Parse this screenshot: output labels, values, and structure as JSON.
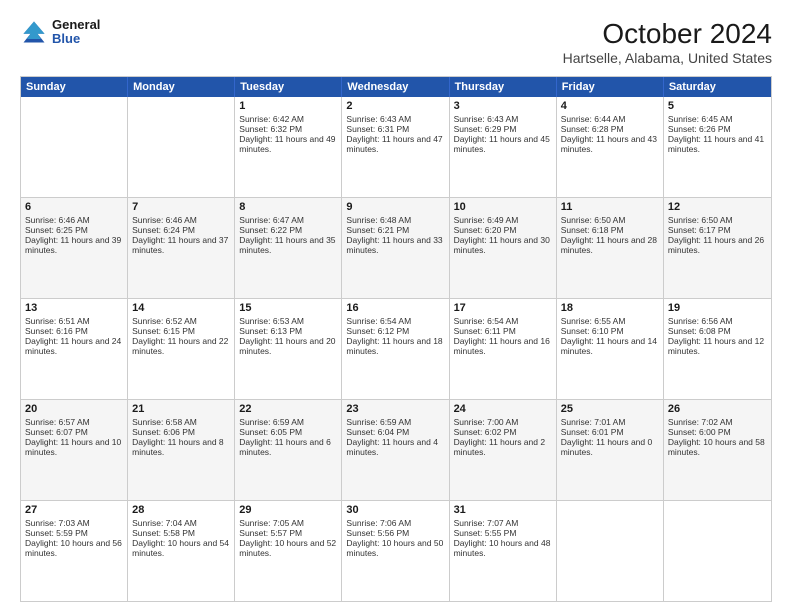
{
  "logo": {
    "general": "General",
    "blue": "Blue"
  },
  "title": "October 2024",
  "subtitle": "Hartselle, Alabama, United States",
  "days_of_week": [
    "Sunday",
    "Monday",
    "Tuesday",
    "Wednesday",
    "Thursday",
    "Friday",
    "Saturday"
  ],
  "weeks": [
    {
      "alt": false,
      "cells": [
        {
          "day": "",
          "content": ""
        },
        {
          "day": "",
          "content": ""
        },
        {
          "day": "1",
          "content": "Sunrise: 6:42 AM\nSunset: 6:32 PM\nDaylight: 11 hours and 49 minutes."
        },
        {
          "day": "2",
          "content": "Sunrise: 6:43 AM\nSunset: 6:31 PM\nDaylight: 11 hours and 47 minutes."
        },
        {
          "day": "3",
          "content": "Sunrise: 6:43 AM\nSunset: 6:29 PM\nDaylight: 11 hours and 45 minutes."
        },
        {
          "day": "4",
          "content": "Sunrise: 6:44 AM\nSunset: 6:28 PM\nDaylight: 11 hours and 43 minutes."
        },
        {
          "day": "5",
          "content": "Sunrise: 6:45 AM\nSunset: 6:26 PM\nDaylight: 11 hours and 41 minutes."
        }
      ]
    },
    {
      "alt": true,
      "cells": [
        {
          "day": "6",
          "content": "Sunrise: 6:46 AM\nSunset: 6:25 PM\nDaylight: 11 hours and 39 minutes."
        },
        {
          "day": "7",
          "content": "Sunrise: 6:46 AM\nSunset: 6:24 PM\nDaylight: 11 hours and 37 minutes."
        },
        {
          "day": "8",
          "content": "Sunrise: 6:47 AM\nSunset: 6:22 PM\nDaylight: 11 hours and 35 minutes."
        },
        {
          "day": "9",
          "content": "Sunrise: 6:48 AM\nSunset: 6:21 PM\nDaylight: 11 hours and 33 minutes."
        },
        {
          "day": "10",
          "content": "Sunrise: 6:49 AM\nSunset: 6:20 PM\nDaylight: 11 hours and 30 minutes."
        },
        {
          "day": "11",
          "content": "Sunrise: 6:50 AM\nSunset: 6:18 PM\nDaylight: 11 hours and 28 minutes."
        },
        {
          "day": "12",
          "content": "Sunrise: 6:50 AM\nSunset: 6:17 PM\nDaylight: 11 hours and 26 minutes."
        }
      ]
    },
    {
      "alt": false,
      "cells": [
        {
          "day": "13",
          "content": "Sunrise: 6:51 AM\nSunset: 6:16 PM\nDaylight: 11 hours and 24 minutes."
        },
        {
          "day": "14",
          "content": "Sunrise: 6:52 AM\nSunset: 6:15 PM\nDaylight: 11 hours and 22 minutes."
        },
        {
          "day": "15",
          "content": "Sunrise: 6:53 AM\nSunset: 6:13 PM\nDaylight: 11 hours and 20 minutes."
        },
        {
          "day": "16",
          "content": "Sunrise: 6:54 AM\nSunset: 6:12 PM\nDaylight: 11 hours and 18 minutes."
        },
        {
          "day": "17",
          "content": "Sunrise: 6:54 AM\nSunset: 6:11 PM\nDaylight: 11 hours and 16 minutes."
        },
        {
          "day": "18",
          "content": "Sunrise: 6:55 AM\nSunset: 6:10 PM\nDaylight: 11 hours and 14 minutes."
        },
        {
          "day": "19",
          "content": "Sunrise: 6:56 AM\nSunset: 6:08 PM\nDaylight: 11 hours and 12 minutes."
        }
      ]
    },
    {
      "alt": true,
      "cells": [
        {
          "day": "20",
          "content": "Sunrise: 6:57 AM\nSunset: 6:07 PM\nDaylight: 11 hours and 10 minutes."
        },
        {
          "day": "21",
          "content": "Sunrise: 6:58 AM\nSunset: 6:06 PM\nDaylight: 11 hours and 8 minutes."
        },
        {
          "day": "22",
          "content": "Sunrise: 6:59 AM\nSunset: 6:05 PM\nDaylight: 11 hours and 6 minutes."
        },
        {
          "day": "23",
          "content": "Sunrise: 6:59 AM\nSunset: 6:04 PM\nDaylight: 11 hours and 4 minutes."
        },
        {
          "day": "24",
          "content": "Sunrise: 7:00 AM\nSunset: 6:02 PM\nDaylight: 11 hours and 2 minutes."
        },
        {
          "day": "25",
          "content": "Sunrise: 7:01 AM\nSunset: 6:01 PM\nDaylight: 11 hours and 0 minutes."
        },
        {
          "day": "26",
          "content": "Sunrise: 7:02 AM\nSunset: 6:00 PM\nDaylight: 10 hours and 58 minutes."
        }
      ]
    },
    {
      "alt": false,
      "cells": [
        {
          "day": "27",
          "content": "Sunrise: 7:03 AM\nSunset: 5:59 PM\nDaylight: 10 hours and 56 minutes."
        },
        {
          "day": "28",
          "content": "Sunrise: 7:04 AM\nSunset: 5:58 PM\nDaylight: 10 hours and 54 minutes."
        },
        {
          "day": "29",
          "content": "Sunrise: 7:05 AM\nSunset: 5:57 PM\nDaylight: 10 hours and 52 minutes."
        },
        {
          "day": "30",
          "content": "Sunrise: 7:06 AM\nSunset: 5:56 PM\nDaylight: 10 hours and 50 minutes."
        },
        {
          "day": "31",
          "content": "Sunrise: 7:07 AM\nSunset: 5:55 PM\nDaylight: 10 hours and 48 minutes."
        },
        {
          "day": "",
          "content": ""
        },
        {
          "day": "",
          "content": ""
        }
      ]
    }
  ]
}
